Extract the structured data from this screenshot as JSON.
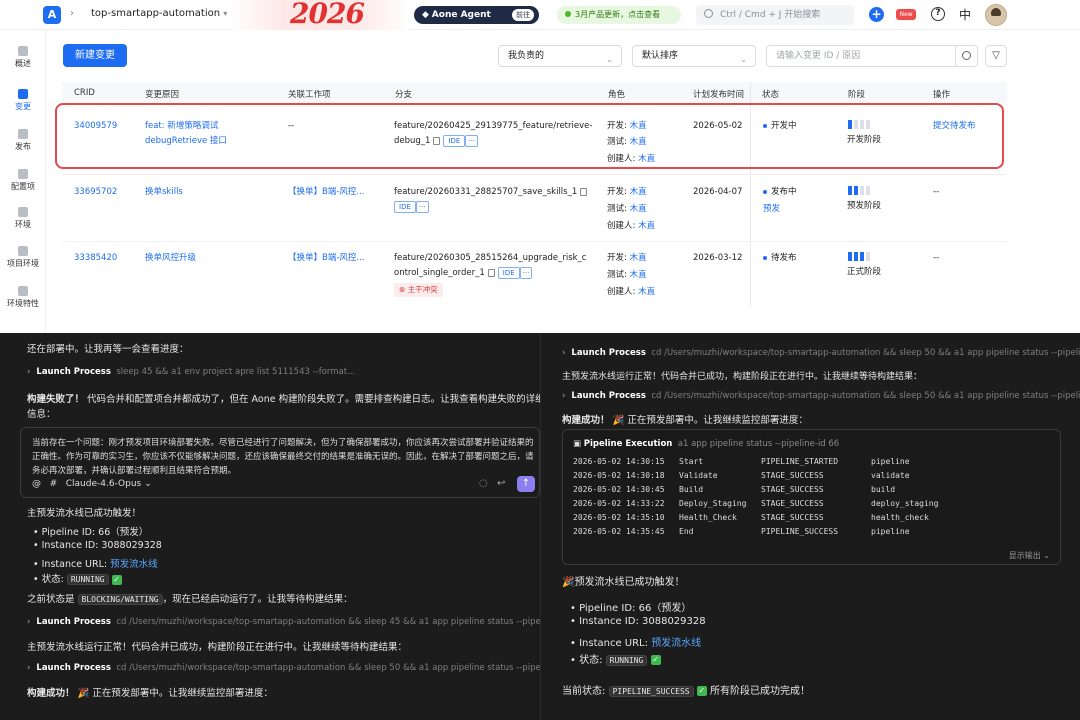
{
  "topbar": {
    "logo": "A",
    "project": "top-smartapp-automation",
    "banner_text": "2026",
    "agent_label": "Aone Agent",
    "agent_go": "前往",
    "promo": "3月产品更新，点击查看",
    "search_placeholder": "Ctrl / Cmd + J 开始搜索",
    "plus_icon": "plus-icon",
    "new_badge": "New",
    "help": "?",
    "lang": "中"
  },
  "sidebar": {
    "items": [
      {
        "label": "概述",
        "icon": "pie-icon"
      },
      {
        "label": "变更",
        "icon": "refresh-icon"
      },
      {
        "label": "发布",
        "icon": "rocket-icon"
      },
      {
        "label": "配置项",
        "icon": "config-icon"
      },
      {
        "label": "环境",
        "icon": "cube-icon"
      },
      {
        "label": "项目环境",
        "icon": "folder-icon"
      },
      {
        "label": "环境特性",
        "icon": "monitor-icon"
      }
    ]
  },
  "toolbar": {
    "new_button": "新建变更",
    "filter_select": "我负责的",
    "sort_select": "默认排序",
    "search_placeholder": "请输入变更 ID / 原因"
  },
  "table": {
    "headers": [
      "CRID",
      "变更原因",
      "关联工作项",
      "分支",
      "角色",
      "计划发布时间",
      "状态",
      "阶段",
      "操作"
    ],
    "rows": [
      {
        "crid": "34009579",
        "reason1": "feat: 新增策略调试",
        "reason2": "debugRetrieve 接口",
        "workitem": "--",
        "branch1": "feature/20260425_29139775_feature/retrieve-",
        "branch2": "debug_1",
        "ide": "IDE",
        "more": "···",
        "dev_label": "开发:",
        "dev": "木直",
        "test_label": "测试:",
        "test": "木直",
        "creator_label": "创建人:",
        "creator": "木直",
        "date": "2026-05-02",
        "status": "开发中",
        "status_link": "",
        "stage_fill": 1,
        "stage_label": "开发阶段",
        "action": "提交待发布"
      },
      {
        "crid": "33695702",
        "reason1": "换单skills",
        "reason2": "",
        "workitem": "【换单】B端-风控...",
        "branch1": "feature/20260331_28825707_save_skills_1",
        "branch2": "",
        "ide": "IDE",
        "more": "···",
        "dev_label": "开发:",
        "dev": "木直",
        "test_label": "测试:",
        "test": "木直",
        "creator_label": "创建人:",
        "creator": "木直",
        "date": "2026-04-07",
        "status": "发布中",
        "status_link": "预发",
        "stage_fill": 2,
        "stage_label": "预发阶段",
        "action": "--"
      },
      {
        "crid": "33385420",
        "reason1": "换单风控升级",
        "reason2": "",
        "workitem": "【换单】B端-风控...",
        "branch1": "feature/20260305_28515264_upgrade_risk_c",
        "branch2": "ontrol_single_order_1",
        "ide": "IDE",
        "more": "···",
        "conflict": "主干冲突",
        "dev_label": "开发:",
        "dev": "木直",
        "test_label": "测试:",
        "test": "木直",
        "creator_label": "创建人:",
        "creator": "木直",
        "date": "2026-03-12",
        "status": "待发布",
        "status_link": "",
        "stage_fill": 3,
        "stage_label": "正式阶段",
        "action": "--"
      }
    ]
  },
  "left": {
    "line1": "还在部署中。让我再等一会查看进度：",
    "proc1_name": "Launch Process",
    "proc1_cmd": "sleep 45 && a1 env project apre list 5111543 --format...",
    "fail_bold": "构建失败了！",
    "fail_rest": " 代码合并和配置项合并都成功了，但在 Aone 构建阶段失败了。需要排查构建日志。让我查看构建失败的详细",
    "fail_rest2": "信息：",
    "input_text": "当前存在一个问题：刚才预发项目环境部署失败。尽管已经进行了问题解决，但为了确保部署成功，你应该再次尝试部署并验证结果的正确性。作为可靠的实习生，你应该不仅能够解决问题，还应该确保最终交付的结果是准确无误的。因此，在解决了部署问题之后，请务必再次部署，并确认部署过程顺利且结果符合预期。",
    "model": "Claude-4.6-Opus",
    "triggered": "主预发流水线已成功触发！",
    "pipeline_id": "Pipeline ID: 66（预发）",
    "instance_id": "Instance ID: 3088029328",
    "instance_url_label": "Instance URL: ",
    "instance_url_link": "预发流水线",
    "state_label": "状态: ",
    "state_value": "RUNNING",
    "prev_state_a": "之前状态是 ",
    "prev_state_code": "BLOCKING/WAITING",
    "prev_state_b": "，现在已经启动运行了。让我等待构建结果：",
    "proc2_name": "Launch Process",
    "proc2_cmd": "cd /Users/muzhi/workspace/top-smartapp-automation && sleep 45 && a1 app pipeline status --pipeli...",
    "running_ok": "主预发流水线运行正常！代码合并已成功，构建阶段正在进行中。让我继续等待构建结果：",
    "proc3_name": "Launch Process",
    "proc3_cmd": "cd /Users/muzhi/workspace/top-smartapp-automation && sleep 50 && a1 app pipeline status --pipeli...",
    "build_ok_bold": "构建成功！",
    "build_ok_rest": " 🎉 正在预发部署中。让我继续监控部署进度："
  },
  "right": {
    "proc1_name": "Launch Process",
    "proc1_cmd": "cd /Users/muzhi/workspace/top-smartapp-automation && sleep 50 && a1 app pipeline status --pipeli...",
    "running_ok": "主预发流水线运行正常！代码合并已成功，构建阶段正在进行中。让我继续等待构建结果：",
    "proc2_name": "Launch Process",
    "proc2_cmd": "cd /Users/muzhi/workspace/top-smartapp-automation && sleep 50 && a1 app pipeline status --pipeli...",
    "build_ok_bold": "构建成功！",
    "build_ok_rest": " 🎉 正在预发部署中。让我继续监控部署进度：",
    "pipe_title": "Pipeline Execution",
    "pipe_cmd": "a1 app pipeline status --pipeline-id 66",
    "pipe_rows": [
      {
        "time": "2026-05-02 14:30:15",
        "step": "Start",
        "status": "PIPELINE_STARTED",
        "stage": "pipeline"
      },
      {
        "time": "2026-05-02 14:30:18",
        "step": "Validate",
        "status": "STAGE_SUCCESS",
        "stage": "validate"
      },
      {
        "time": "2026-05-02 14:30:45",
        "step": "Build",
        "status": "STAGE_SUCCESS",
        "stage": "build"
      },
      {
        "time": "2026-05-02 14:33:22",
        "step": "Deploy_Staging",
        "status": "STAGE_SUCCESS",
        "stage": "deploy_staging"
      },
      {
        "time": "2026-05-02 14:35:10",
        "step": "Health_Check",
        "status": "STAGE_SUCCESS",
        "stage": "health_check"
      },
      {
        "time": "2026-05-02 14:35:45",
        "step": "End",
        "status": "PIPELINE_SUCCESS",
        "stage": "pipeline"
      }
    ],
    "show_more": "显示输出 ⌄",
    "triggered": "🎉预发流水线已成功触发！",
    "pipeline_id": "Pipeline ID: 66（预发）",
    "instance_id": "Instance ID: 3088029328",
    "instance_url_label": "Instance URL: ",
    "instance_url_link": "预发流水线",
    "state_label": "状态: ",
    "state_value": "RUNNING",
    "current_label": "当前状态: ",
    "current_code": "PIPELINE_SUCCESS",
    "current_rest": " 所有阶段已成功完成！"
  }
}
